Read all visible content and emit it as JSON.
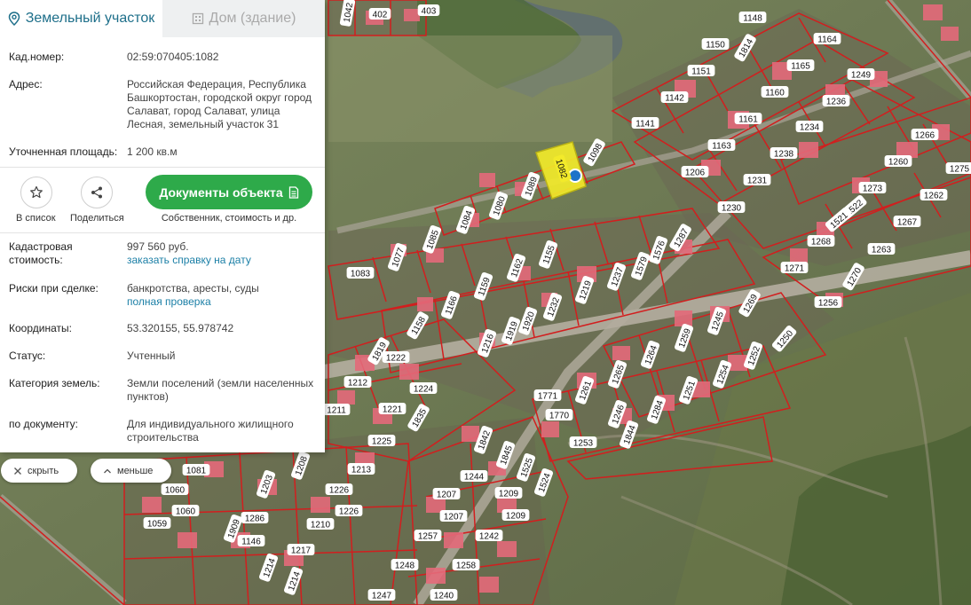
{
  "tabs": [
    {
      "label": "Земельный участок",
      "icon": "map-pin-icon",
      "active": true
    },
    {
      "label": "Дом (здание)",
      "icon": "building-icon",
      "active": false
    }
  ],
  "info": {
    "cad_number_label": "Кад.номер:",
    "cad_number": "02:59:070405:1082",
    "address_label": "Адрес:",
    "address": "Российская Федерация, Республика Башкортостан, городской округ город Салават, город Салават, улица Лесная, земельный участок 31",
    "area_label": "Уточненная площадь:",
    "area": "1 200 кв.м"
  },
  "actions": {
    "favorite_label": "В список",
    "share_label": "Поделиться",
    "documents_button": "Документы объекта",
    "documents_sub": "Собственник, стоимость и др."
  },
  "details": {
    "cad_value_label": "Кадастровая стоимость:",
    "cad_value": "997 560 руб.",
    "cad_value_link": "заказать справку на дату",
    "risks_label": "Риски при сделке:",
    "risks": "банкротства, аресты, суды",
    "risks_link": "полная проверка",
    "coords_label": "Координаты:",
    "coords": "53.320155, 55.978742",
    "status_label": "Статус:",
    "status": "Учтенный",
    "category_label": "Категория земель:",
    "category": "Земли поселений (земли населенных пунктов)",
    "by_doc_label": "по документу:",
    "by_doc": "Для индивидуального жилищного строительства"
  },
  "controls": {
    "hide_label": "скрыть",
    "less_label": "меньше"
  },
  "map": {
    "plots": [
      {
        "id": "plot-402",
        "label": "402"
      },
      {
        "id": "plot-403",
        "label": "403"
      },
      {
        "id": "plot-1042",
        "label": "1042"
      },
      {
        "id": "plot-1148",
        "label": "1148"
      },
      {
        "id": "plot-1164",
        "label": "1164"
      },
      {
        "id": "plot-1150",
        "label": "1150"
      },
      {
        "id": "plot-1814",
        "label": "1814"
      },
      {
        "id": "plot-1151",
        "label": "1151"
      },
      {
        "id": "plot-1165",
        "label": "1165"
      },
      {
        "id": "plot-1249",
        "label": "1249"
      },
      {
        "id": "plot-1142",
        "label": "1142"
      },
      {
        "id": "plot-1160",
        "label": "1160"
      },
      {
        "id": "plot-1236",
        "label": "1236"
      },
      {
        "id": "plot-1141",
        "label": "1141"
      },
      {
        "id": "plot-1161",
        "label": "1161"
      },
      {
        "id": "plot-1234",
        "label": "1234"
      },
      {
        "id": "plot-1266",
        "label": "1266"
      },
      {
        "id": "plot-1163",
        "label": "1163"
      },
      {
        "id": "plot-1238",
        "label": "1238"
      },
      {
        "id": "plot-1260",
        "label": "1260"
      },
      {
        "id": "plot-1275",
        "label": "1275"
      },
      {
        "id": "plot-1098",
        "label": "1098"
      },
      {
        "id": "plot-1206",
        "label": "1206"
      },
      {
        "id": "plot-1231",
        "label": "1231"
      },
      {
        "id": "plot-1273",
        "label": "1273"
      },
      {
        "id": "plot-1262",
        "label": "1262"
      },
      {
        "id": "plot-1089",
        "label": "1089"
      },
      {
        "id": "plot-1080",
        "label": "1080"
      },
      {
        "id": "plot-1084",
        "label": "1084"
      },
      {
        "id": "plot-1230",
        "label": "1230"
      },
      {
        "id": "plot-1522",
        "label": "1522"
      },
      {
        "id": "plot-1521",
        "label": "1521"
      },
      {
        "id": "plot-1267",
        "label": "1267"
      },
      {
        "id": "plot-1085",
        "label": "1085"
      },
      {
        "id": "plot-1077",
        "label": "1077"
      },
      {
        "id": "plot-1287",
        "label": "1287"
      },
      {
        "id": "plot-1268",
        "label": "1268"
      },
      {
        "id": "plot-1263",
        "label": "1263"
      },
      {
        "id": "plot-1576",
        "label": "1576"
      },
      {
        "id": "plot-1155",
        "label": "1155"
      },
      {
        "id": "plot-1083",
        "label": "1083"
      },
      {
        "id": "plot-1162",
        "label": "1162"
      },
      {
        "id": "plot-1579",
        "label": "1579"
      },
      {
        "id": "plot-1271",
        "label": "1271"
      },
      {
        "id": "plot-1270",
        "label": "1270"
      },
      {
        "id": "plot-1237",
        "label": "1237"
      },
      {
        "id": "plot-1159",
        "label": "1159"
      },
      {
        "id": "plot-1219",
        "label": "1219"
      },
      {
        "id": "plot-1166",
        "label": "1166"
      },
      {
        "id": "plot-1232",
        "label": "1232"
      },
      {
        "id": "plot-1269",
        "label": "1269"
      },
      {
        "id": "plot-1256",
        "label": "1256"
      },
      {
        "id": "plot-1158",
        "label": "1158"
      },
      {
        "id": "plot-1920",
        "label": "1920"
      },
      {
        "id": "plot-1245",
        "label": "1245"
      },
      {
        "id": "plot-1919",
        "label": "1919"
      },
      {
        "id": "plot-1259",
        "label": "1259"
      },
      {
        "id": "plot-1250",
        "label": "1250"
      },
      {
        "id": "plot-1216",
        "label": "1216"
      },
      {
        "id": "plot-1264",
        "label": "1264"
      },
      {
        "id": "plot-1819",
        "label": "1819"
      },
      {
        "id": "plot-1222",
        "label": "1222"
      },
      {
        "id": "plot-1252",
        "label": "1252"
      },
      {
        "id": "plot-1254",
        "label": "1254"
      },
      {
        "id": "plot-1265",
        "label": "1265"
      },
      {
        "id": "plot-1212",
        "label": "1212"
      },
      {
        "id": "plot-1224",
        "label": "1224"
      },
      {
        "id": "plot-1261",
        "label": "1261"
      },
      {
        "id": "plot-1251",
        "label": "1251"
      },
      {
        "id": "plot-1771",
        "label": "1771"
      },
      {
        "id": "plot-1221",
        "label": "1221"
      },
      {
        "id": "plot-1211",
        "label": "1211"
      },
      {
        "id": "plot-1284",
        "label": "1284"
      },
      {
        "id": "plot-1835",
        "label": "1835"
      },
      {
        "id": "plot-1246",
        "label": "1246"
      },
      {
        "id": "plot-1770",
        "label": "1770"
      },
      {
        "id": "plot-1844",
        "label": "1844"
      },
      {
        "id": "plot-1842",
        "label": "1842"
      },
      {
        "id": "plot-1225",
        "label": "1225"
      },
      {
        "id": "plot-1253",
        "label": "1253"
      },
      {
        "id": "plot-1845",
        "label": "1845"
      },
      {
        "id": "plot-1081",
        "label": "1081"
      },
      {
        "id": "plot-1208",
        "label": "1208"
      },
      {
        "id": "plot-1213",
        "label": "1213"
      },
      {
        "id": "plot-1525",
        "label": "1525"
      },
      {
        "id": "plot-1244",
        "label": "1244"
      },
      {
        "id": "plot-1524",
        "label": "1524"
      },
      {
        "id": "plot-1203",
        "label": "1203"
      },
      {
        "id": "plot-1226a",
        "label": "1226"
      },
      {
        "id": "plot-1060a",
        "label": "1060"
      },
      {
        "id": "plot-1207a",
        "label": "1207"
      },
      {
        "id": "plot-1209a",
        "label": "1209"
      },
      {
        "id": "plot-1226b",
        "label": "1226"
      },
      {
        "id": "plot-1060b",
        "label": "1060"
      },
      {
        "id": "plot-1286",
        "label": "1286"
      },
      {
        "id": "plot-1207b",
        "label": "1207"
      },
      {
        "id": "plot-1209b",
        "label": "1209"
      },
      {
        "id": "plot-1059",
        "label": "1059"
      },
      {
        "id": "plot-1210",
        "label": "1210"
      },
      {
        "id": "plot-1909",
        "label": "1909"
      },
      {
        "id": "plot-1146",
        "label": "1146"
      },
      {
        "id": "plot-1257",
        "label": "1257"
      },
      {
        "id": "plot-1242",
        "label": "1242"
      },
      {
        "id": "plot-1217",
        "label": "1217"
      },
      {
        "id": "plot-1248",
        "label": "1248"
      },
      {
        "id": "plot-1258",
        "label": "1258"
      },
      {
        "id": "plot-1214a",
        "label": "1214"
      },
      {
        "id": "plot-1214b",
        "label": "1214"
      },
      {
        "id": "plot-1247",
        "label": "1247"
      },
      {
        "id": "plot-1240",
        "label": "1240"
      }
    ],
    "selected_label": "1082",
    "colors": {
      "selected": "#f2ea2a",
      "boundary": "#d21e1e",
      "marker": "#1d73c9"
    }
  }
}
